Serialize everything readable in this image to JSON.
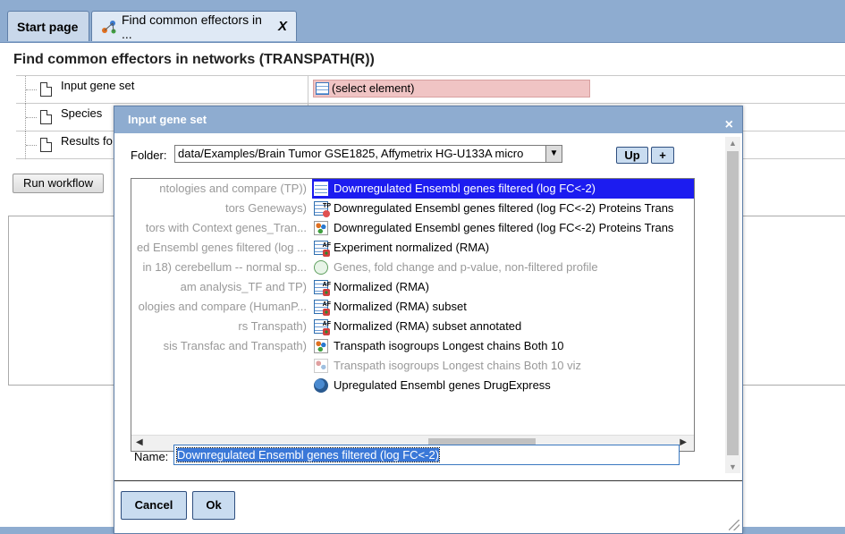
{
  "tabs": [
    {
      "label": "Start page"
    },
    {
      "label": "Find common effectors in ...",
      "close": "X"
    }
  ],
  "page": {
    "title": "Find common effectors in networks (TRANSPATH(R))",
    "params": [
      {
        "label": "Input gene set",
        "value": "(select element)"
      },
      {
        "label": "Species"
      },
      {
        "label": "Results fo"
      }
    ],
    "run_button": "Run workflow"
  },
  "dialog": {
    "title": "Input gene set",
    "close": "×",
    "folder_label": "Folder:",
    "folder_value": "data/Examples/Brain Tumor GSE1825, Affymetrix HG-U133A micro",
    "up_button": "Up",
    "plus_button": "+",
    "left_items": [
      "ntologies and compare (TP))",
      "tors Geneways)",
      "tors with Context genes_Tran...",
      "ed Ensembl genes filtered (log ...",
      "in 18) cerebellum -- normal sp...",
      "am analysis_TF and TP)",
      "ologies and compare (HumanP...",
      "rs Transpath)",
      "sis Transfac and Transpath)"
    ],
    "right_items": [
      {
        "label": "Downregulated Ensembl genes filtered (log FC<-2)",
        "icon": "table-icon",
        "state": "selected"
      },
      {
        "label": "Downregulated Ensembl genes filtered (log FC<-2) Proteins Trans",
        "icon": "tp-table-icon",
        "state": "normal"
      },
      {
        "label": "Downregulated Ensembl genes filtered (log FC<-2) Proteins Trans",
        "icon": "network-icon",
        "state": "normal"
      },
      {
        "label": "Experiment normalized (RMA)",
        "icon": "af-table-icon",
        "state": "normal"
      },
      {
        "label": "Genes, fold change and p-value, non-filtered profile",
        "icon": "profile-icon",
        "state": "disabled"
      },
      {
        "label": "Normalized (RMA)",
        "icon": "af-table-icon",
        "state": "normal"
      },
      {
        "label": "Normalized (RMA) subset",
        "icon": "af-table-icon",
        "state": "normal"
      },
      {
        "label": "Normalized (RMA) subset annotated",
        "icon": "af-table-icon",
        "state": "normal"
      },
      {
        "label": "Transpath isogroups Longest chains Both 10",
        "icon": "network-icon",
        "state": "normal"
      },
      {
        "label": "Transpath isogroups Longest chains Both 10 viz",
        "icon": "viz-icon",
        "state": "disabled"
      },
      {
        "label": "Upregulated Ensembl genes DrugExpress",
        "icon": "drug-icon",
        "state": "normal"
      }
    ],
    "name_label": "Name:",
    "name_value": "Downregulated Ensembl genes filtered (log FC<-2)",
    "cancel_button": "Cancel",
    "ok_button": "Ok"
  },
  "colors": {
    "header_blue": "#8eacd0",
    "selection_blue": "#1c1cf0",
    "error_field": "#f0c4c4",
    "button_fill": "#c9dcf0"
  }
}
